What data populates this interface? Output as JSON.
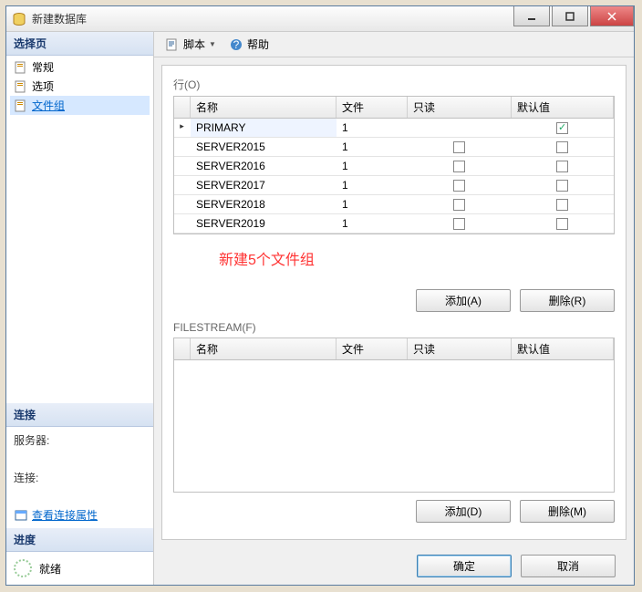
{
  "window": {
    "title": "新建数据库"
  },
  "sidebar": {
    "select_page_header": "选择页",
    "items": [
      {
        "label": "常规"
      },
      {
        "label": "选项"
      },
      {
        "label": "文件组"
      }
    ],
    "connection_header": "连接",
    "server_label": "服务器:",
    "connection_label": "连接:",
    "view_props": "查看连接属性",
    "progress_header": "进度",
    "progress_status": "就绪"
  },
  "toolbar": {
    "script": "脚本",
    "help": "帮助"
  },
  "main": {
    "rows_label": "行(O)",
    "headers": {
      "name": "名称",
      "file": "文件",
      "readonly": "只读",
      "default": "默认值"
    },
    "rows": [
      {
        "name": "PRIMARY",
        "file": "1",
        "readonly": null,
        "default": true
      },
      {
        "name": "SERVER2015",
        "file": "1",
        "readonly": false,
        "default": false
      },
      {
        "name": "SERVER2016",
        "file": "1",
        "readonly": false,
        "default": false
      },
      {
        "name": "SERVER2017",
        "file": "1",
        "readonly": false,
        "default": false
      },
      {
        "name": "SERVER2018",
        "file": "1",
        "readonly": false,
        "default": false
      },
      {
        "name": "SERVER2019",
        "file": "1",
        "readonly": false,
        "default": false
      }
    ],
    "annotation": "新建5个文件组",
    "add_a": "添加(A)",
    "del_r": "删除(R)",
    "filestream_label": "FILESTREAM(F)",
    "add_d": "添加(D)",
    "del_m": "删除(M)"
  },
  "dialog": {
    "ok": "确定",
    "cancel": "取消"
  }
}
